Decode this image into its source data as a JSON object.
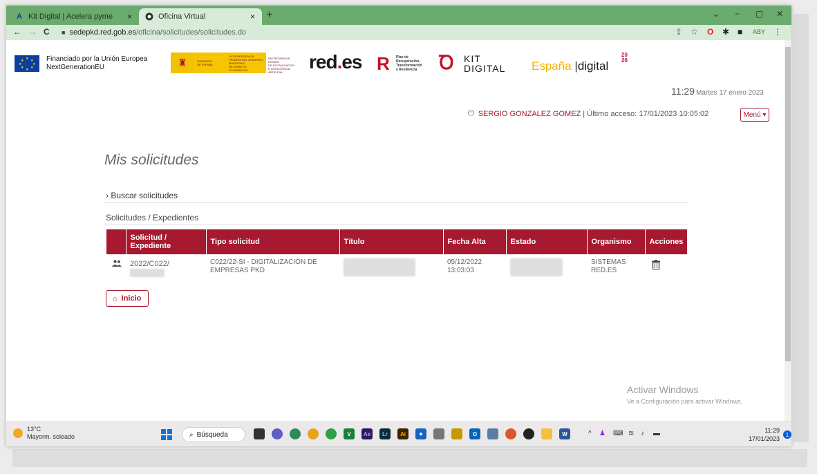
{
  "browser": {
    "tabs": [
      {
        "label": "Kit Digital | Acelera pyme",
        "close": "×"
      },
      {
        "label": "Oficina Virtual",
        "close": "×"
      }
    ],
    "new_tab": "+",
    "window_controls": [
      "⌄",
      "−",
      "▢",
      "✕"
    ],
    "nav": {
      "back": "←",
      "forward": "→",
      "reload": "C"
    },
    "url_host": "sedepkd.red.gob.es",
    "url_path": "/oficina/solicitudes/solicitudes.do"
  },
  "header": {
    "eu_line1": "Financiado por la Unión Europea",
    "eu_line2": "NextGenerationEU",
    "redes_a": "red",
    "redes_dot": ".",
    "redes_b": "es",
    "prtr_l1": "Plan de",
    "prtr_l2": "Recuperación,",
    "prtr_l3": "Transformación",
    "prtr_l4": "y Resiliencia",
    "kit_l1": "KIT",
    "kit_l2": "DIGITAL",
    "espana_a": "España",
    "espana_sep": "|",
    "espana_b": "digital",
    "espana_sup1": "20",
    "espana_sup2": "26",
    "time": "11:29",
    "date": "Martes 17 enero 2023",
    "user_name": "SERGIO GONZALEZ GOMEZ",
    "last_access": "| Último acceso: 17/01/2023 10:05:02",
    "menu_label": "Menú ▾"
  },
  "main": {
    "title": "Mis solicitudes",
    "search_toggle": "› Buscar solicitudes",
    "section_title": "Solicitudes / Expedientes",
    "columns": [
      "Solicitud / Expediente",
      "Tipo solicitud",
      "Título",
      "Fecha Alta",
      "Estado",
      "Organismo",
      "Acciones"
    ],
    "row": {
      "expediente": "2022/C022/",
      "tipo_l1": "C022/22-SI - DIGITALIZACIÓN DE",
      "tipo_l2": "EMPRESAS PKD",
      "fecha_l1": "05/12/2022",
      "fecha_l2": "13:03:03",
      "organismo_l1": "SISTEMAS",
      "organismo_l2": "RED.ES"
    },
    "inicio_label": "Inicio"
  },
  "watermark": {
    "line1": "Activar Windows",
    "line2": "Ve a Configuración para activar Windows."
  },
  "taskbar": {
    "weather_temp": "13°C",
    "weather_desc": "Mayorm. soleado",
    "search_label": "Búsqueda",
    "clock_time": "11:29",
    "clock_date": "17/01/2023",
    "notif_count": "1"
  }
}
